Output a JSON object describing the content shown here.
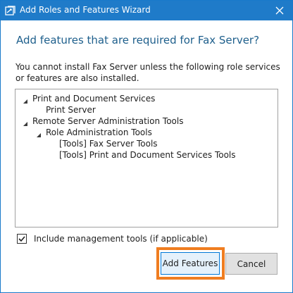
{
  "window": {
    "title": "Add Roles and Features Wizard",
    "icons": {
      "app": "wizard-app-icon",
      "close": "close-icon"
    }
  },
  "dialog": {
    "heading": "Add features that are required for Fax Server?",
    "description": "You cannot install Fax Server unless the following role services or features are also installed."
  },
  "tree": {
    "items": [
      {
        "label": "Print and Document Services",
        "level": 0,
        "expanded": true
      },
      {
        "label": "Print Server",
        "level": 1,
        "expanded": null
      },
      {
        "label": "Remote Server Administration Tools",
        "level": 0,
        "expanded": true
      },
      {
        "label": "Role Administration Tools",
        "level": 1,
        "expanded": true
      },
      {
        "label": "[Tools] Fax Server Tools",
        "level": 2,
        "expanded": null
      },
      {
        "label": "[Tools] Print and Document Services Tools",
        "level": 2,
        "expanded": null
      }
    ]
  },
  "options": {
    "include_tools_label": "Include management tools (if applicable)",
    "include_tools_checked": true
  },
  "buttons": {
    "add_features": "Add Features",
    "cancel": "Cancel"
  },
  "colors": {
    "titlebar": "#1f7bc9",
    "heading": "#1e5f8c",
    "highlight": "#f07d20",
    "default_button_border": "#0078d7"
  }
}
